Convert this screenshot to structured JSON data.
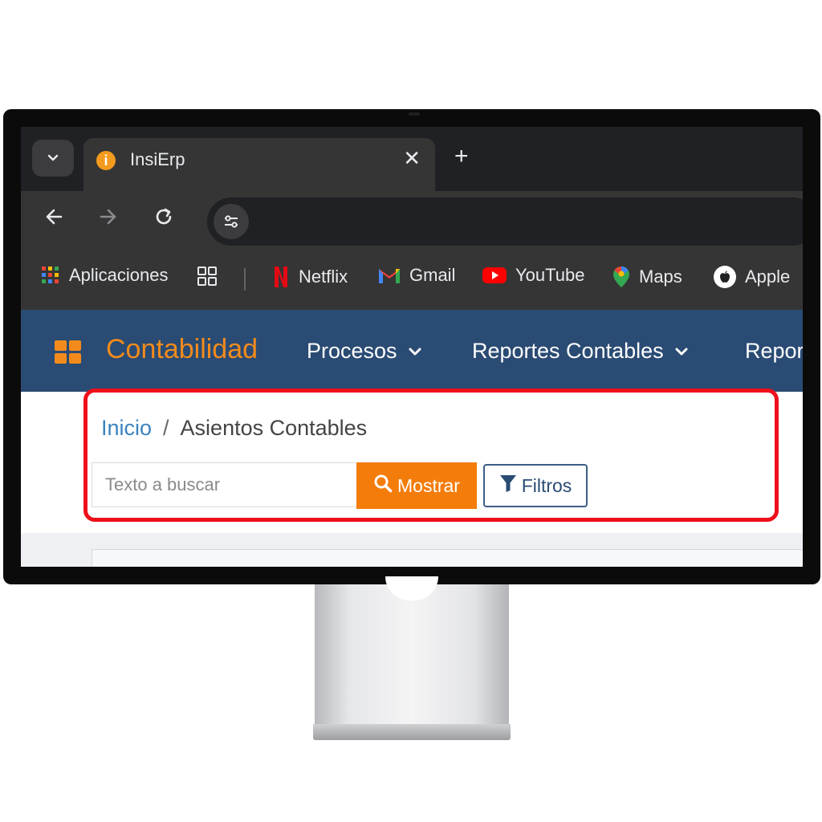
{
  "browser": {
    "tab": {
      "title": "InsiErp",
      "favicon_letter": "i"
    },
    "bookmarks": [
      {
        "label": "Aplicaciones",
        "icon": "apps-grid-icon"
      },
      {
        "label": "Netflix",
        "icon": "netflix-icon"
      },
      {
        "label": "Gmail",
        "icon": "gmail-icon"
      },
      {
        "label": "YouTube",
        "icon": "youtube-icon"
      },
      {
        "label": "Maps",
        "icon": "maps-icon"
      },
      {
        "label": "Apple",
        "icon": "apple-icon"
      }
    ]
  },
  "app": {
    "brand": "Contabilidad",
    "menu": [
      {
        "label": "Procesos"
      },
      {
        "label": "Reportes Contables"
      },
      {
        "label": "Repor"
      }
    ],
    "breadcrumb": {
      "home": "Inicio",
      "separator": "/",
      "current": "Asientos Contables"
    },
    "search": {
      "placeholder": "Texto a buscar",
      "value": ""
    },
    "buttons": {
      "show": "Mostrar",
      "filters": "Filtros"
    }
  },
  "colors": {
    "nav_bg": "#2a4b73",
    "accent_orange": "#f47c0a",
    "link_blue": "#3b83c0",
    "highlight_red": "#ee0f1b"
  }
}
